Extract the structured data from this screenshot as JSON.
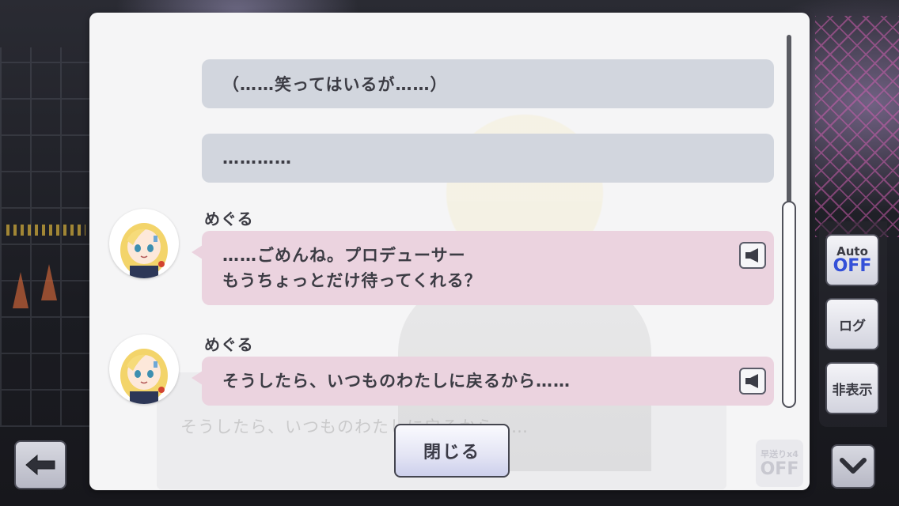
{
  "log": {
    "entries": [
      {
        "type": "narration",
        "text": "（……笑ってはいるが……）"
      },
      {
        "type": "narration",
        "text": "…………"
      },
      {
        "type": "speech",
        "speaker": "めぐる",
        "text": "……ごめんね。プロデューサー\nもうちょっとだけ待ってくれる？",
        "voice_icon": "speaker-icon"
      },
      {
        "type": "speech",
        "speaker": "めぐる",
        "text": "そうしたら、いつものわたしに戻るから……",
        "voice_icon": "speaker-icon"
      }
    ],
    "close_label": "閉じる"
  },
  "background_text": "そうしたら、いつものわたしに戻るから……",
  "side_controls": {
    "auto_label": "Auto",
    "auto_value": "OFF",
    "log_label": "ログ",
    "hide_label": "非表示"
  },
  "ghost_speed": {
    "label": "早送りx4",
    "value": "OFF"
  },
  "icons": {
    "back": "back-arrow-icon",
    "down": "chevron-down-icon"
  },
  "colors": {
    "narration_bubble": "#d2d6de",
    "speech_bubble": "#ebd3df",
    "auto_off": "#3450d8"
  }
}
